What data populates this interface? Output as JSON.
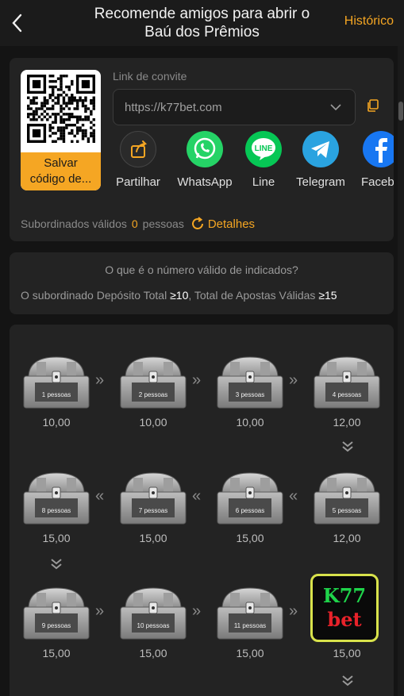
{
  "header": {
    "title_line1": "Recomende amigos para abrir o",
    "title_line2": "Baú dos Prêmios",
    "history_label": "Histórico"
  },
  "invite": {
    "save_qr_line1": "Salvar",
    "save_qr_line2": "código de...",
    "link_label": "Link de convite",
    "link_value": "https://k77bet.com",
    "share": [
      {
        "label": "Partilhar",
        "icon": "share-icon",
        "color": "#2a2a2a"
      },
      {
        "label": "WhatsApp",
        "icon": "whatsapp-icon",
        "color": "#25d366"
      },
      {
        "label": "Line",
        "icon": "line-icon",
        "color": "#06c755"
      },
      {
        "label": "Telegram",
        "icon": "telegram-icon",
        "color": "#2aa3e0"
      },
      {
        "label": "Facebo",
        "icon": "facebook-icon",
        "color": "#1877f2"
      }
    ],
    "subordinates_label": "Subordinados válidos",
    "subordinates_count": "0",
    "subordinates_unit": "pessoas",
    "details_label": "Detalhes"
  },
  "info": {
    "question": "O que é o número válido de indicados?",
    "cond_prefix": "O subordinado Depósito Total ",
    "cond_deposit": "≥10",
    "cond_sep": ",  Total de Apostas Válidas ",
    "cond_bets": "≥15"
  },
  "chests": [
    {
      "label": "1 pessoas",
      "amount": "10,00"
    },
    {
      "label": "2 pessoas",
      "amount": "10,00"
    },
    {
      "label": "3 pessoas",
      "amount": "10,00"
    },
    {
      "label": "4 pessoas",
      "amount": "12,00"
    },
    {
      "label": "5 pessoas",
      "amount": "12,00"
    },
    {
      "label": "6 pessoas",
      "amount": "15,00"
    },
    {
      "label": "7 pessoas",
      "amount": "15,00"
    },
    {
      "label": "8 pessoas",
      "amount": "15,00"
    },
    {
      "label": "9 pessoas",
      "amount": "15,00"
    },
    {
      "label": "10 pessoas",
      "amount": "15,00"
    },
    {
      "label": "11 pessoas",
      "amount": "15,00"
    },
    {
      "label": "",
      "amount": "15,00",
      "logo_line1": "K77",
      "logo_line2": "bet"
    }
  ],
  "colors": {
    "accent": "#f5a623",
    "background": "#141414",
    "card": "#232323"
  }
}
